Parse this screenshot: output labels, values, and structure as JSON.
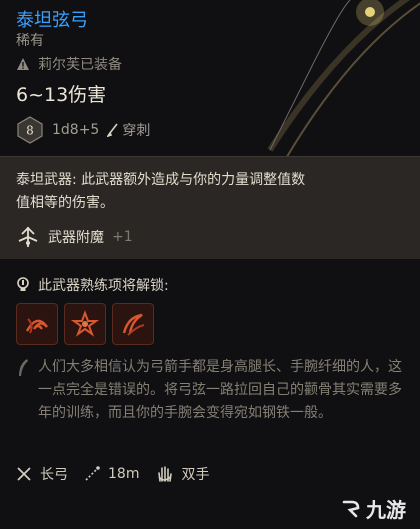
{
  "item": {
    "title": "泰坦弦弓",
    "rarity": "稀有",
    "equipped_by": "莉尔芙已装备",
    "damage": "6~13伤害",
    "dice_label": "8",
    "dice_formula": "1d8+5",
    "damage_type": "穿刺"
  },
  "ability": {
    "text": "泰坦武器: 此武器额外造成与你的力量调整值数值相等的伤害。",
    "enchant_label": "武器附魔",
    "enchant_value": "+1"
  },
  "proficiency": {
    "unlock_label": "此武器熟练项将解锁:",
    "skill_icons": [
      "skill-icon-1",
      "skill-icon-2",
      "skill-icon-3"
    ]
  },
  "lore": "人们大多相信认为弓箭手都是身高腿长、手腕纤细的人，这一点完全是错误的。将弓弦一路拉回自己的颧骨其实需要多年的训练，而且你的手腕会变得宛如钢铁一般。",
  "properties": {
    "weapon_type": "长弓",
    "range": "18m",
    "handed": "双手"
  },
  "watermark": {
    "text": "九游"
  },
  "colors": {
    "title": "#3aa0ff",
    "ability_bg": "#2a2724",
    "skill_fire": "#c4472a"
  }
}
